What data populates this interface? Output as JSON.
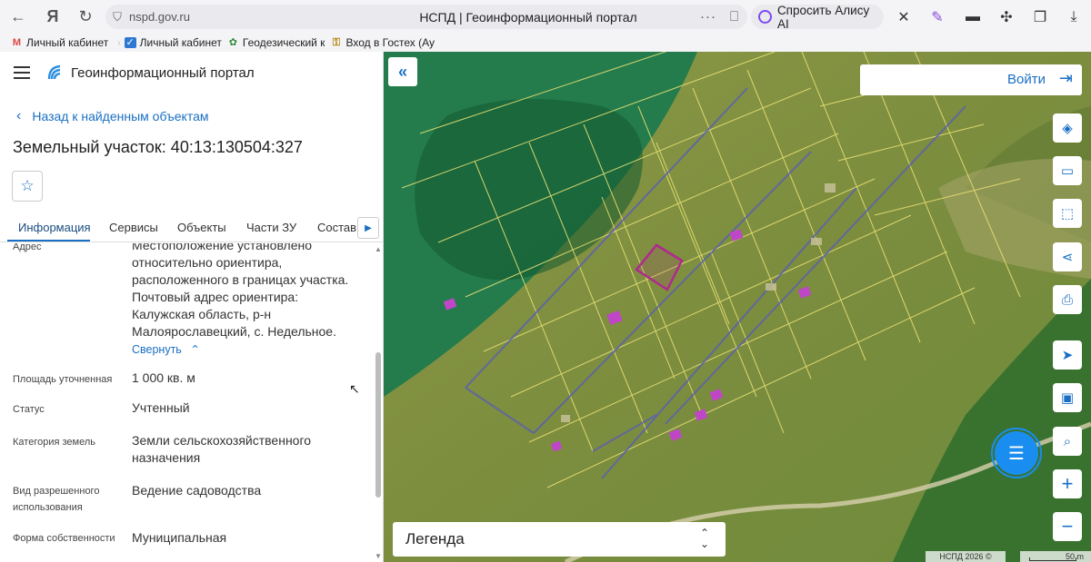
{
  "browser": {
    "url": "nspd.gov.ru",
    "tab_title": "НСПД | Геоинформационный портал",
    "alice_label": "Спросить Алису AI",
    "bookmarks": [
      {
        "label": "Личный кабинет",
        "icon": "gmail-icon"
      },
      {
        "label": "Личный кабинет",
        "icon": "gosuslugi-icon"
      },
      {
        "label": "Геодезический к",
        "icon": "geodesy-icon"
      },
      {
        "label": "Вход в Гостех (Ау",
        "icon": "key-icon"
      }
    ]
  },
  "panel": {
    "portal_title": "Геоинформационный портал",
    "back_label": "Назад к найденным объектам",
    "parcel_title": "Земельный участок: 40:13:130504:327",
    "tabs": [
      {
        "label": "Информация"
      },
      {
        "label": "Сервисы"
      },
      {
        "label": "Объекты"
      },
      {
        "label": "Части ЗУ"
      },
      {
        "label": "Состав"
      }
    ],
    "properties": [
      {
        "label": "Адрес",
        "value": "Местоположение установлено относительно ориентира, расположенного в границах участка. Почтовый адрес ориентира: Калужская область, р-н Малоярославецкий, с. Недельное."
      },
      {
        "label": "Площадь уточненная",
        "value": "1 000 кв. м"
      },
      {
        "label": "Статус",
        "value": "Учтенный"
      },
      {
        "label": "Категория земель",
        "value": "Земли сельскохозяйственного назначения"
      },
      {
        "label": "Вид разрешенного использования",
        "value": "Ведение садоводства"
      },
      {
        "label": "Форма собственности",
        "value": "Муниципальная"
      }
    ],
    "collapse_label": "Свернуть"
  },
  "map": {
    "login_label": "Войти",
    "legend_label": "Легенда",
    "copyright": "НСПД 2026 ©",
    "scale_label": "50 m",
    "colors": {
      "accent": "#1a6fc4",
      "forest_zone": "#1f7a4d",
      "parcel_lines": "#e6df74",
      "road_lines": "#5a5fb0",
      "selected_parcel": "#b0288f",
      "buildings": "#c046c8"
    },
    "tools": [
      "layers-icon",
      "ruler-icon",
      "select-area-icon",
      "share-icon",
      "print-icon",
      "locate-icon",
      "minimap-icon",
      "search-location-icon",
      "zoom-in-icon",
      "zoom-out-icon"
    ]
  }
}
